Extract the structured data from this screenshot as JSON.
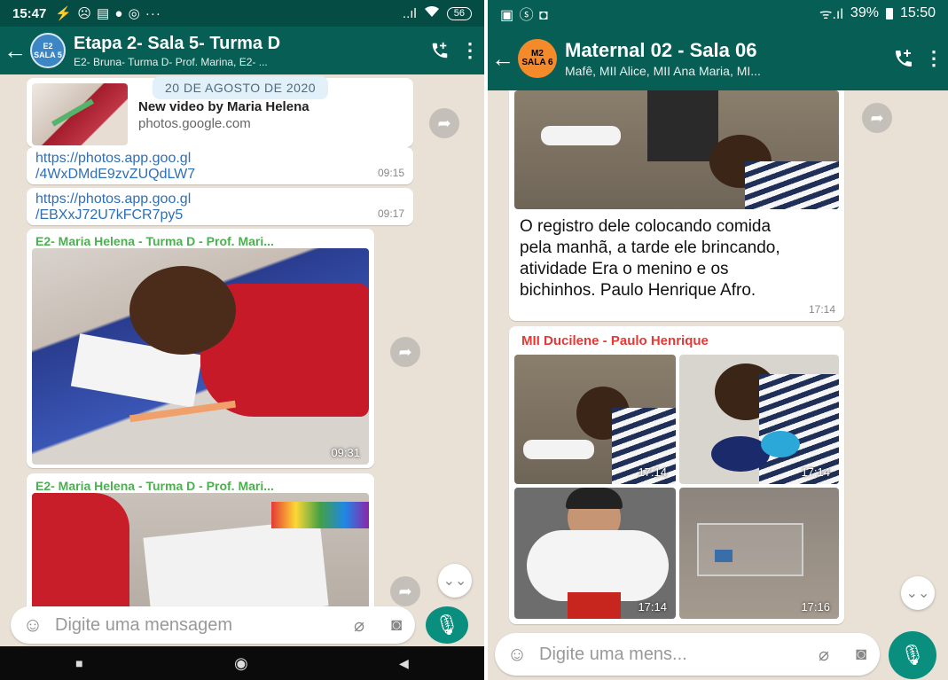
{
  "left": {
    "status": {
      "time": "15:47",
      "icons": "⚡ ☹ ▤ ● ◎ ···",
      "signal": "..ıl",
      "battery": "56"
    },
    "header": {
      "avatar_line1": "E2",
      "avatar_line2": "SALA 5",
      "title": "Etapa 2- Sala 5- Turma D",
      "subtitle": "E2- Bruna- Turma D- Prof. Marina, E2- ..."
    },
    "date_chip": "20 DE AGOSTO DE 2020",
    "link_preview": {
      "title": "New video by Maria Helena",
      "domain": "photos.google.com"
    },
    "messages": [
      {
        "text": "https://photos.app.goo.gl/4WxDMdE9zvZUQdLW7",
        "line1": "https://photos.app.goo.gl",
        "line2": "/4WxDMdE9zvZUQdLW7",
        "time": "09:15"
      },
      {
        "text": "https://photos.app.goo.gl/EBXxJ72U7kFCR7py5",
        "line1": "https://photos.app.goo.gl",
        "line2": "/EBXxJ72U7kFCR7py5",
        "time": "09:17"
      }
    ],
    "image_messages": [
      {
        "sender": "E2- Maria Helena - Turma D - Prof. Mari...",
        "time": "09:31"
      },
      {
        "sender": "E2- Maria Helena - Turma D - Prof. Mari..."
      }
    ],
    "composer": {
      "placeholder": "Digite uma mensagem"
    }
  },
  "right": {
    "status": {
      "icons": "▣ ⓢ ◘",
      "signal": "ᯤ.ıl",
      "battery": "39%",
      "time": "15:50"
    },
    "header": {
      "avatar_line1": "M2",
      "avatar_line2": "SALA 6",
      "title": "Maternal 02 - Sala 06",
      "subtitle": "Mafê, MII Alice, MII Ana Maria, MI..."
    },
    "caption_message": {
      "text": "O  registro dele colocando comida pela manhã, a tarde ele brincando,  atividade Era o menino e os bichinhos.  Paulo Henrique Afro.",
      "time": "17:14"
    },
    "album": {
      "sender": "MII Ducilene - Paulo Henrique",
      "times": [
        "17:14",
        "17:14",
        "17:14",
        "17:16"
      ]
    },
    "composer": {
      "placeholder": "Digite uma mens..."
    }
  },
  "colors": {
    "header": "#075e54",
    "chat_bg": "#e9e1d6",
    "mic": "#0a8f7f",
    "link": "#2f6fb5",
    "sender_green": "#4caf50",
    "sender_red": "#e53935"
  },
  "icons": [
    "back-arrow-icon",
    "add-call-icon",
    "more-vert-icon",
    "forward-icon",
    "emoji-icon",
    "attach-icon",
    "camera-icon",
    "mic-icon",
    "scroll-down-icon"
  ]
}
